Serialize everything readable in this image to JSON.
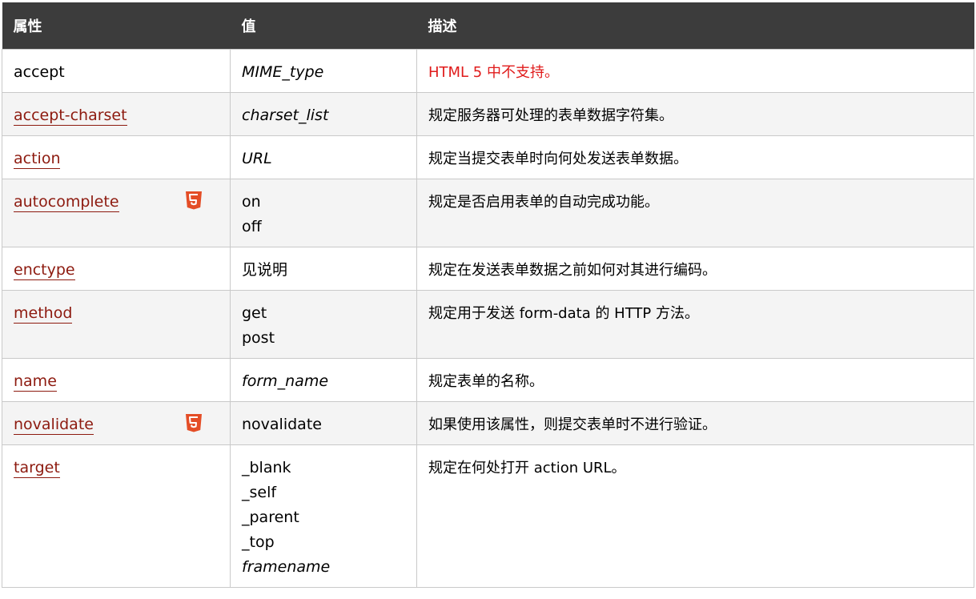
{
  "headers": {
    "attribute": "属性",
    "value": "值",
    "description": "描述"
  },
  "rows": [
    {
      "name": "accept",
      "is_link": false,
      "html5": false,
      "values": [
        {
          "text": "MIME_type",
          "italic": true
        }
      ],
      "description": "HTML 5 中不支持。",
      "desc_red": true
    },
    {
      "name": "accept-charset",
      "is_link": true,
      "html5": false,
      "values": [
        {
          "text": "charset_list",
          "italic": true
        }
      ],
      "description": "规定服务器可处理的表单数据字符集。"
    },
    {
      "name": "action",
      "is_link": true,
      "html5": false,
      "values": [
        {
          "text": "URL",
          "italic": true
        }
      ],
      "description": "规定当提交表单时向何处发送表单数据。"
    },
    {
      "name": "autocomplete",
      "is_link": true,
      "html5": true,
      "values": [
        {
          "text": "on",
          "italic": false
        },
        {
          "text": "off",
          "italic": false
        }
      ],
      "description": "规定是否启用表单的自动完成功能。"
    },
    {
      "name": "enctype",
      "is_link": true,
      "html5": false,
      "values": [
        {
          "text": "见说明",
          "italic": false
        }
      ],
      "description": "规定在发送表单数据之前如何对其进行编码。"
    },
    {
      "name": "method",
      "is_link": true,
      "html5": false,
      "values": [
        {
          "text": "get",
          "italic": false
        },
        {
          "text": "post",
          "italic": false
        }
      ],
      "description": "规定用于发送 form-data 的 HTTP 方法。"
    },
    {
      "name": "name",
      "is_link": true,
      "html5": false,
      "values": [
        {
          "text": "form_name",
          "italic": true
        }
      ],
      "description": "规定表单的名称。"
    },
    {
      "name": "novalidate",
      "is_link": true,
      "html5": true,
      "values": [
        {
          "text": "novalidate",
          "italic": false
        }
      ],
      "description": "如果使用该属性，则提交表单时不进行验证。"
    },
    {
      "name": "target",
      "is_link": true,
      "html5": false,
      "values": [
        {
          "text": "_blank",
          "italic": false
        },
        {
          "text": "_self",
          "italic": false
        },
        {
          "text": "_parent",
          "italic": false
        },
        {
          "text": "_top",
          "italic": false
        },
        {
          "text": "framename",
          "italic": true
        }
      ],
      "description": "规定在何处打开 action URL。"
    }
  ],
  "colors": {
    "header_bg": "#3c3c3c",
    "link": "#8d1a0f",
    "alt_row": "#f4f4f4",
    "red_text": "#e01b1b",
    "html5_badge": "#e44d26"
  },
  "icons": {
    "html5": "html5-icon"
  }
}
